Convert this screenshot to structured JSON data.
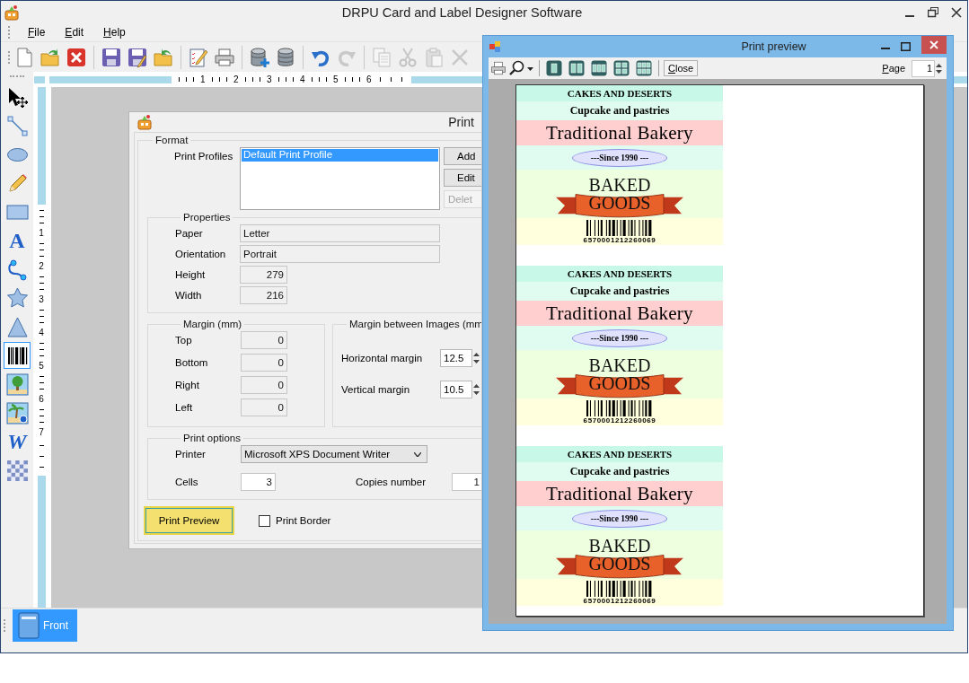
{
  "window": {
    "title": "DRPU Card and Label Designer Software"
  },
  "menu": [
    "File",
    "Edit",
    "Help"
  ],
  "toolbar": [
    {
      "kind": "new",
      "disabled": false
    },
    {
      "kind": "open",
      "disabled": false
    },
    {
      "kind": "close",
      "disabled": false
    },
    {
      "kind": "separator"
    },
    {
      "kind": "save",
      "disabled": false
    },
    {
      "kind": "save-as",
      "disabled": false
    },
    {
      "kind": "export",
      "disabled": false
    },
    {
      "kind": "separator"
    },
    {
      "kind": "edit",
      "disabled": false
    },
    {
      "kind": "print",
      "disabled": false
    },
    {
      "kind": "separator"
    },
    {
      "kind": "db-add",
      "disabled": false
    },
    {
      "kind": "db",
      "disabled": false
    },
    {
      "kind": "separator"
    },
    {
      "kind": "undo",
      "disabled": false
    },
    {
      "kind": "redo",
      "disabled": true
    },
    {
      "kind": "separator"
    },
    {
      "kind": "copy",
      "disabled": true
    },
    {
      "kind": "cut",
      "disabled": true
    },
    {
      "kind": "paste",
      "disabled": true
    },
    {
      "kind": "delete",
      "disabled": true
    }
  ],
  "tools": [
    {
      "kind": "pointer",
      "selected": false
    },
    {
      "kind": "line",
      "selected": false
    },
    {
      "kind": "ellipse",
      "selected": false
    },
    {
      "kind": "pencil",
      "selected": false
    },
    {
      "kind": "rectangle",
      "selected": false
    },
    {
      "kind": "text",
      "glyph": "A",
      "selected": false
    },
    {
      "kind": "curve",
      "selected": false
    },
    {
      "kind": "star",
      "selected": false
    },
    {
      "kind": "triangle",
      "selected": false
    },
    {
      "kind": "barcode",
      "selected": true
    },
    {
      "kind": "picture",
      "selected": false
    },
    {
      "kind": "picture-library",
      "selected": false
    },
    {
      "kind": "wordart",
      "glyph": "W",
      "selected": false
    },
    {
      "kind": "pattern",
      "selected": false
    }
  ],
  "rulers": {
    "horizontal": [
      "1",
      "2",
      "3",
      "4",
      "5",
      "6"
    ],
    "vertical": [
      "1",
      "2",
      "3",
      "4",
      "5",
      "6",
      "7"
    ]
  },
  "page_tabs": [
    {
      "label": "Front",
      "selected": true
    }
  ],
  "print_dialog": {
    "title": "Print",
    "format": {
      "legend": "Format",
      "profiles_label": "Print Profiles",
      "profiles": [
        {
          "label": "Default Print Profile",
          "selected": true
        }
      ],
      "buttons": [
        {
          "label": "Add",
          "disabled": false
        },
        {
          "label": "Edit",
          "disabled": false
        },
        {
          "label": "Delet",
          "disabled": true
        }
      ]
    },
    "properties": {
      "legend": "Properties",
      "fields": [
        {
          "label": "Paper",
          "value": "Letter",
          "kind": "wide"
        },
        {
          "label": "Orientation",
          "value": "Portrait",
          "kind": "wide"
        },
        {
          "label": "Height",
          "value": "279",
          "kind": "number"
        },
        {
          "label": "Width",
          "value": "216",
          "kind": "number"
        }
      ]
    },
    "margin": {
      "legend": "Margin (mm)",
      "fields": [
        {
          "label": "Top",
          "value": "0"
        },
        {
          "label": "Bottom",
          "value": "0"
        },
        {
          "label": "Right",
          "value": "0"
        },
        {
          "label": "Left",
          "value": "0"
        }
      ]
    },
    "image_margin": {
      "legend": "Margin between Images (mm",
      "fields": [
        {
          "label": "Horizontal margin",
          "value": "12.5"
        },
        {
          "label": "Vertical margin",
          "value": "10.5"
        }
      ]
    },
    "print_options": {
      "legend": "Print options",
      "printer_label": "Printer",
      "printer": "Microsoft XPS Document Writer",
      "cells_label": "Cells",
      "cells": "3",
      "copies_label": "Copies number",
      "copies": "1"
    },
    "preview_button": "Print Preview",
    "print_border": {
      "label": "Print Border",
      "checked": false
    }
  },
  "print_preview": {
    "title": "Print preview",
    "toolbar": [
      {
        "kind": "print"
      },
      {
        "kind": "zoom"
      },
      {
        "kind": "separator"
      },
      {
        "kind": "one-page"
      },
      {
        "kind": "two-pages"
      },
      {
        "kind": "three-pages"
      },
      {
        "kind": "four-pages"
      },
      {
        "kind": "six-pages"
      },
      {
        "kind": "separator"
      }
    ],
    "close_button": "Close",
    "page_label": "Page",
    "page": "1",
    "labels": [
      {
        "heading": "CAKES AND DESERTS",
        "subheading": "Cupcake and pastries",
        "name": "Traditional Bakery",
        "since": "---Since 1990 ---",
        "badge": [
          "BAKED",
          "GOODS"
        ],
        "barcode_number": "6570001212260069"
      },
      {
        "heading": "CAKES AND DESERTS",
        "subheading": "Cupcake and pastries",
        "name": "Traditional Bakery",
        "since": "---Since 1990 ---",
        "badge": [
          "BAKED",
          "GOODS"
        ],
        "barcode_number": "6570001212260069"
      },
      {
        "heading": "CAKES AND DESERTS",
        "subheading": "Cupcake and pastries",
        "name": "Traditional Bakery",
        "since": "---Since 1990 ---",
        "badge": [
          "BAKED",
          "GOODS"
        ],
        "barcode_number": "6570001212260069"
      }
    ]
  }
}
